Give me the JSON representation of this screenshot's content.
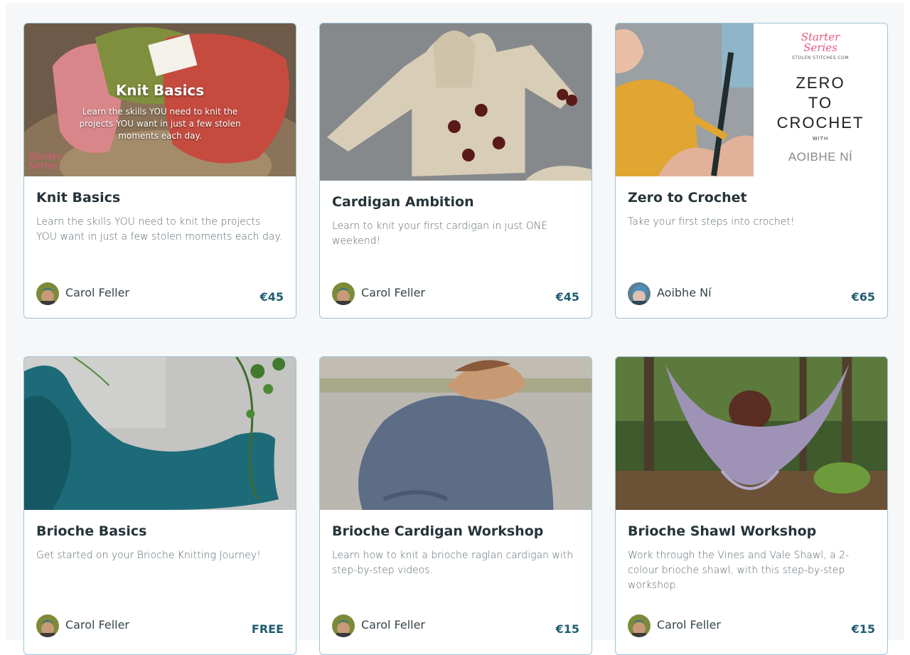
{
  "courses": [
    {
      "title": "Knit Basics",
      "description": "Learn the skills YOU need to knit the projects YOU want in just a few stolen moments each day.",
      "author": "Carol Feller",
      "price": "€45",
      "thumb": {
        "overlay_title": "Knit Basics",
        "overlay_text": "Learn the skills YOU need to knit the projects YOU want in just a few stolen moments each day.",
        "tag_text": "Starter Series"
      }
    },
    {
      "title": "Cardigan Ambition",
      "description": "Learn to knit your first cardigan in just ONE weekend!",
      "author": "Carol Feller",
      "price": "€45"
    },
    {
      "title": "Zero to Crochet",
      "description": "Take your first steps into crochet!",
      "author": "Aoibhe Ní",
      "price": "€65",
      "thumb": {
        "series": "Starter Series",
        "brand": "STOLEN STITCHES.COM",
        "big_1": "ZERO",
        "big_2": "TO",
        "big_3": "CROCHET",
        "with": "WITH",
        "author_big": "AOIBHE NÍ"
      }
    },
    {
      "title": "Brioche Basics",
      "description": "Get started on your Brioche Knitting Journey!",
      "author": "Carol Feller",
      "price": "FREE"
    },
    {
      "title": "Brioche Cardigan Workshop",
      "description": "Learn how to knit a brioche raglan cardigan with step-by-step videos.",
      "author": "Carol Feller",
      "price": "€15"
    },
    {
      "title": "Brioche Shawl Workshop",
      "description": "Work through the Vines and Vale Shawl, a 2-colour brioche shawl, with this step-by-step workshop.",
      "author": "Carol Feller",
      "price": "€15"
    }
  ],
  "colors": {
    "card_border": "#9bc5d2",
    "price": "#1f5d70",
    "title": "#26343a",
    "accent_pink": "#e3577d"
  }
}
